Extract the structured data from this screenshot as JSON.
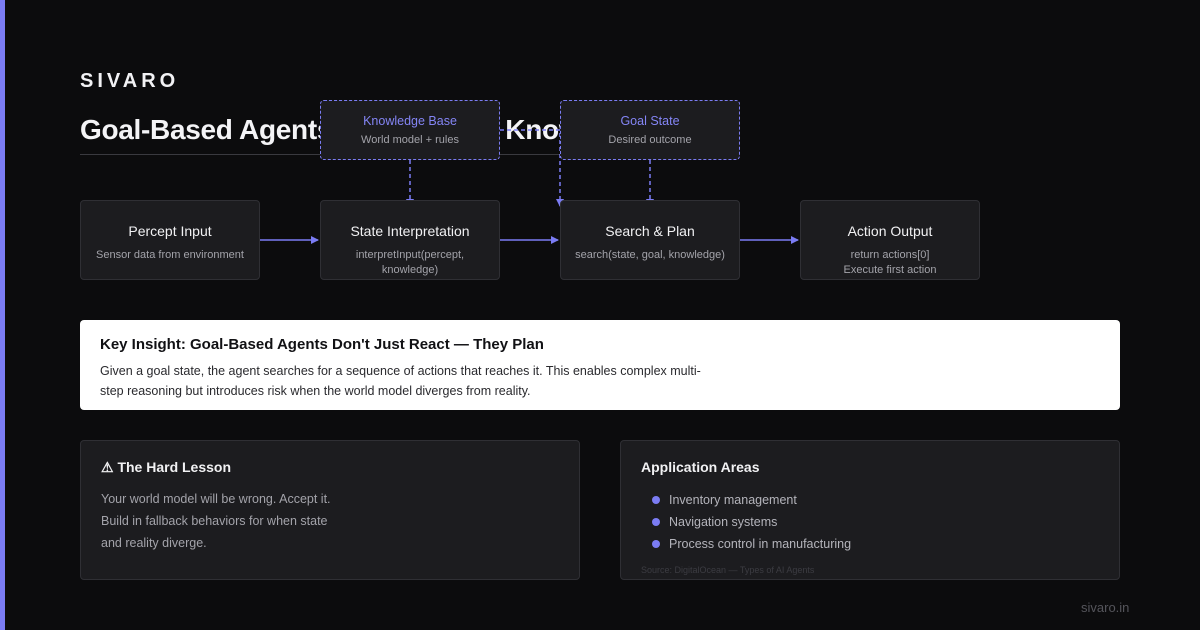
{
  "brand": "SIVARO",
  "title": "Goal-Based Agents: Perception, Knowledge, Plan",
  "diagram": {
    "nodes": [
      {
        "title": "Percept Input",
        "sub": "Sensor data from environment"
      },
      {
        "title": "State Interpretation",
        "sub": "interpretInput(percept, knowledge)"
      },
      {
        "title": "Search & Plan",
        "sub": "search(state, goal, knowledge)"
      },
      {
        "title": "Action Output",
        "sub": "return actions[0]",
        "sub2": "Execute first action"
      }
    ],
    "inputs": [
      {
        "title": "Knowledge Base",
        "sub": "World model + rules"
      },
      {
        "title": "Goal State",
        "sub": "Desired outcome"
      }
    ],
    "accent": "#7b7cf3"
  },
  "insight": {
    "title": "Key Insight: Goal-Based Agents Don't Just React — They Plan",
    "body": "Given a goal state, the agent searches for a sequence of actions that reaches it. This enables complex multi-step reasoning but introduces risk when the world model diverges from reality."
  },
  "lesson": {
    "icon": "warning-icon",
    "title": "⚠ The Hard Lesson",
    "body": "Your world model will be wrong. Accept it. Build in fallback behaviors for when state and reality diverge."
  },
  "areas": {
    "title": "Application Areas",
    "items": [
      "Inventory management",
      "Navigation systems",
      "Process control in manufacturing"
    ],
    "source": "Source: DigitalOcean — Types of AI Agents"
  },
  "footer": "sivaro.in"
}
